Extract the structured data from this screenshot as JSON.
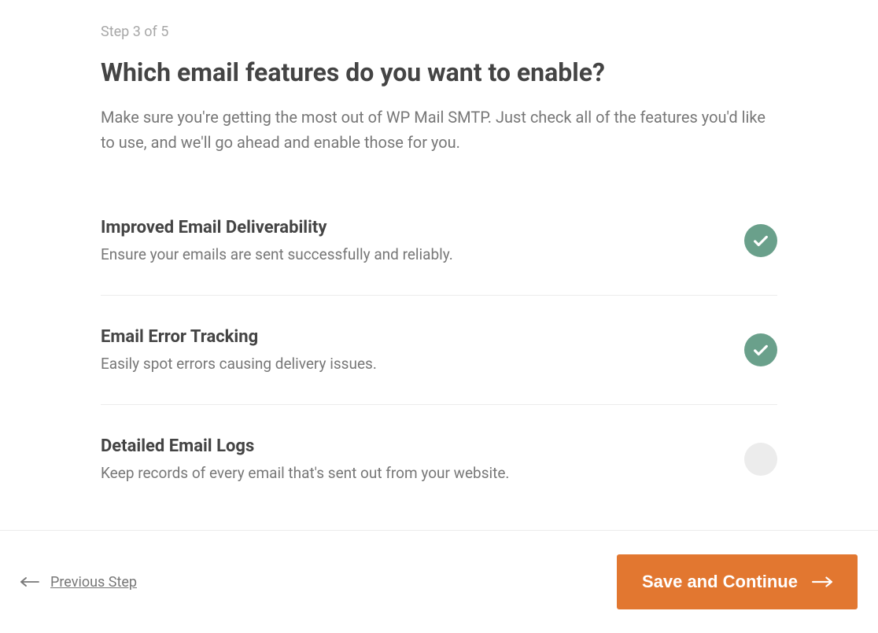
{
  "step_label": "Step 3 of 5",
  "heading": "Which email features do you want to enable?",
  "description": "Make sure you're getting the most out of WP Mail SMTP. Just check all of the features you'd like to use, and we'll go ahead and enable those for you.",
  "features": [
    {
      "title": "Improved Email Deliverability",
      "desc": "Ensure your emails are sent successfully and reliably.",
      "enabled": true
    },
    {
      "title": "Email Error Tracking",
      "desc": "Easily spot errors causing delivery issues.",
      "enabled": true
    },
    {
      "title": "Detailed Email Logs",
      "desc": "Keep records of every email that's sent out from your website.",
      "enabled": false
    }
  ],
  "footer": {
    "previous_label": "Previous Step",
    "continue_label": "Save and Continue"
  },
  "colors": {
    "accent": "#e27730",
    "toggle_on": "#6aa08b",
    "toggle_off": "#ececec"
  }
}
